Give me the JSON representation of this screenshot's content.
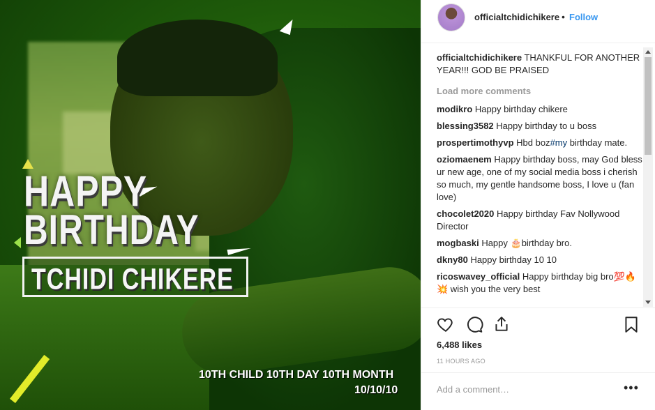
{
  "post_image": {
    "headline_line1": "HAPPY",
    "headline_line2": "BIRTHDAY",
    "name_banner": "TCHIDI CHIKERE",
    "subcaption_line1": "10TH CHILD 10TH DAY 10TH MONTH",
    "subcaption_line2": "10/10/10",
    "accent_colors": {
      "yellow": "#e2ec2a",
      "green": "#9be04a",
      "white": "#ffffff"
    }
  },
  "header": {
    "username": "officialtchidichikere",
    "separator": "•",
    "follow_label": "Follow",
    "follow_color": "#3897f0"
  },
  "caption": {
    "username": "officialtchidichikere",
    "text": "THANKFUL FOR ANOTHER YEAR!!! GOD BE PRAISED"
  },
  "load_more_label": "Load more comments",
  "comments": [
    {
      "username": "modikro",
      "text": "Happy birthday chikere"
    },
    {
      "username": "blessing3582",
      "text": "Happy birthday to u boss"
    },
    {
      "username": "prospertimothyvp",
      "text_before": "Hbd boz",
      "hashtag": "#my",
      "text_after": " birthday mate."
    },
    {
      "username": "oziomaenem",
      "text": "Happy birthday boss, may God bless ur new age, one of my social media boss i cherish so much, my gentle handsome boss, I love u (fan love)"
    },
    {
      "username": "chocolet2020",
      "text": "Happy birthday Fav Nollywood Director"
    },
    {
      "username": "mogbaski",
      "text_before": "Happy ",
      "emoji": "🎂",
      "text_after": "birthday bro."
    },
    {
      "username": "dkny80",
      "text": "Happy birthday 10 10"
    },
    {
      "username": "ricoswavey_official",
      "text_before": "Happy birthday big bro",
      "emoji": "💯🔥💥",
      "text_after": " wish you the very best"
    }
  ],
  "actions": {
    "icons": [
      "heart-icon",
      "comment-icon",
      "share-icon",
      "bookmark-icon"
    ]
  },
  "likes_label": "6,488 likes",
  "timestamp": "11 HOURS AGO",
  "add_comment": {
    "placeholder": "Add a comment…",
    "more_label": "•••"
  }
}
